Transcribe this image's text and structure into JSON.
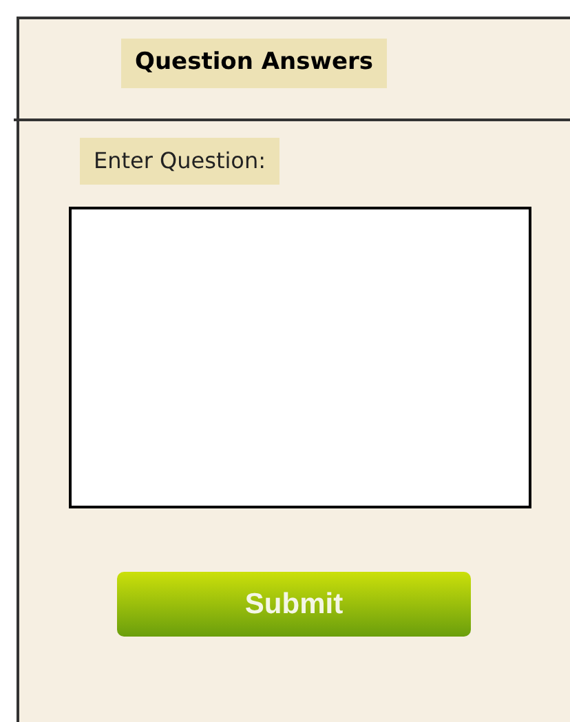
{
  "header": {
    "title": "Question Answers"
  },
  "form": {
    "label": "Enter Question:",
    "button": "Submit"
  }
}
